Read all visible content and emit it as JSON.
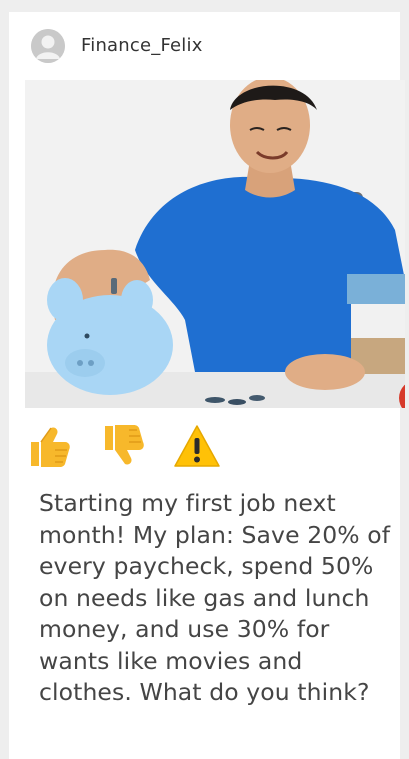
{
  "post": {
    "username": "Finance_Felix",
    "text": "Starting my first job next month! My plan: Save 20% of every paycheck, spend 50% on needs like gas and lunch money, and use 30% for wants like movies and clothes. What do you think?"
  },
  "icons": {
    "avatar": "user-avatar-icon",
    "reactions": [
      "thumbs-up-icon",
      "thumbs-down-icon",
      "warning-icon"
    ]
  },
  "colors": {
    "reaction_yellow": "#F7B82B",
    "warning_yellow": "#FFC107",
    "text": "#454545"
  }
}
